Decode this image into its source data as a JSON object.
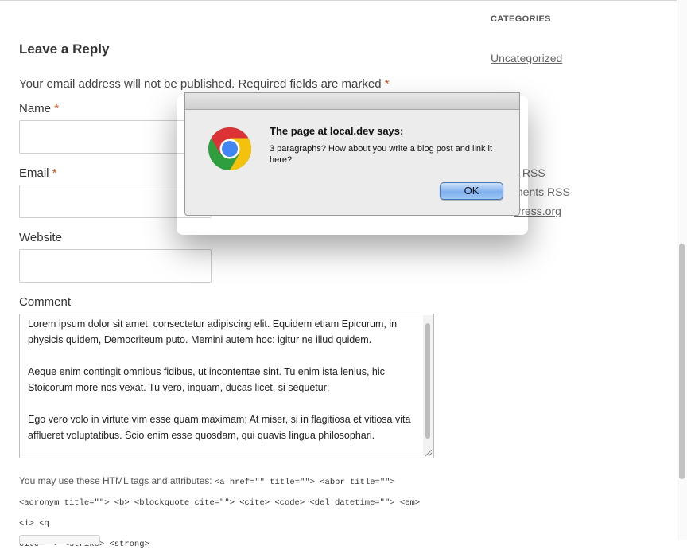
{
  "page": {
    "reply_title": "Leave a Reply",
    "notes_text": "Your email address will not be published. Required fields are marked ",
    "required_mark": "*"
  },
  "form": {
    "name_label": "Name",
    "email_label": "Email",
    "website_label": "Website",
    "comment_label": "Comment",
    "comment_paragraphs": [
      "Lorem ipsum dolor sit amet, consectetur adipiscing elit. Equidem etiam Epicurum, in physicis quidem, Democriteum puto. Memini autem hoc: igitur ne illud quidem.",
      "Aeque enim contingit omnibus fidibus, ut incontentae sint. Tu enim ista lenius, hic Stoicorum more nos vexat. Tu vero, inquam, ducas licet, si sequetur;",
      "Ego vero volo in virtute vim esse quam maximam; At miser, si in flagitiosa et vitiosa vita afflueret voluptatibus. Scio enim esse quosdam, qui quavis lingua philosophari."
    ],
    "allowed_tags_intro": "You may use these HTML tags and attributes: ",
    "allowed_tags_line1": "<a href=\"\" title=\"\"> <abbr title=\"\">",
    "allowed_tags_line2": "<acronym title=\"\"> <b> <blockquote cite=\"\"> <cite> <code> <del datetime=\"\"> <em> <i> <q",
    "allowed_tags_line3": "cite=\"\"> <strike> <strong>"
  },
  "sidebar": {
    "categories_heading": "CATEGORIES",
    "category_link": "Uncategorized",
    "meta_links": [
      "s RSS",
      "ments RSS",
      "Press.org"
    ]
  },
  "alert": {
    "title": "The page at local.dev says:",
    "message": "3 paragraphs? How about you write a blog post and link it here?",
    "ok_label": "OK",
    "icon": "chrome-logo-icon"
  }
}
